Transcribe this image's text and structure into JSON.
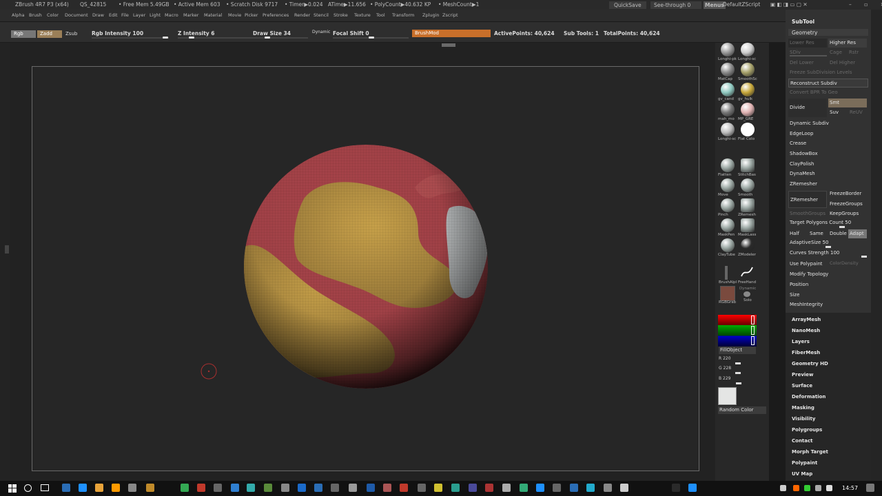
{
  "titlebar": {
    "app": "ZBrush 4R7 P3 (x64)",
    "qs": "QS_42815",
    "free_mem": "• Free Mem 5.49GB",
    "active_mem": "• Active Mem 603",
    "scratch": "• Scratch Disk 9717",
    "timer": "• Timer▶0.024",
    "atime": "ATime▶11.656",
    "polycount": "• PolyCount▶40.632 KP",
    "meshcount": "• MeshCount▶1",
    "quicksave": "QuickSave",
    "see_through": "See-through  0",
    "menus": "Menus",
    "script": "DefaultZScript"
  },
  "menubar": [
    "Alpha",
    "Brush",
    "Color",
    "Document",
    "Draw",
    "Edit",
    "File",
    "Layer",
    "Light",
    "Macro",
    "Marker",
    "Material",
    "Movie",
    "Picker",
    "Preferences",
    "Render",
    "Stencil",
    "Stroke",
    "Texture",
    "Tool",
    "Transform",
    "Zplugin",
    "Zscript"
  ],
  "toolbar": {
    "rgb": "Rgb",
    "zadd": "Zadd",
    "zsub": "Zsub",
    "rgb_intensity": "Rgb Intensity 100",
    "z_intensity": "Z Intensity 6",
    "draw_size": "Draw Size 34",
    "dynamic": "Dynamic",
    "focal_shift": "Focal Shift 0",
    "brushmod": "BrushMod",
    "active_points": "ActivePoints: 40,624",
    "sub_tools": "Sub Tools: 1",
    "total_points": "TotalPoints: 40,624"
  },
  "brushes": [
    {
      "label": "Longhi-pk",
      "color": "#9a9a9a"
    },
    {
      "label": "Longhi-sc",
      "color": "#cfcfcf"
    },
    {
      "label": "MatCap",
      "color": "#8a8a8a"
    },
    {
      "label": "SmoothSc",
      "color": "#a6a16a"
    },
    {
      "label": "gv_cand",
      "color": "#8fc9c0"
    },
    {
      "label": "gv_hulk",
      "color": "#c7a83a"
    },
    {
      "label": "mah_mo",
      "color": "#777777"
    },
    {
      "label": "MP_GRE",
      "color": "#e0b2b2"
    },
    {
      "label": "Longhi-sc",
      "color": "#bdbdbd"
    },
    {
      "label": "Flat Colo",
      "color": "#ffffff"
    },
    {
      "label": "Flatten",
      "color": "#9aa6a2"
    },
    {
      "label": "StitchBas",
      "color": "#9aa6a2"
    },
    {
      "label": "Move",
      "color": "#9aa6a2"
    },
    {
      "label": "Smooth",
      "color": "#9aa6a2"
    },
    {
      "label": "Pinch",
      "color": "#9aa6a2"
    },
    {
      "label": "ZRemesh",
      "color": "#9aa6a2"
    },
    {
      "label": "MaskPen",
      "color": "#9aa6a2"
    },
    {
      "label": "MaskLass",
      "color": "#9aa6a2"
    },
    {
      "label": "ClayTube",
      "color": "#9aa6a2"
    },
    {
      "label": "ZModeler",
      "color": "#2a2a2a"
    }
  ],
  "stroke": {
    "alpha_label": "BrushAlpl",
    "freehand_label": "FreeHand",
    "texture_label": "RGBGrab",
    "dynamic_label": "Dynamic",
    "solo_label": "Solo"
  },
  "color": {
    "fill_object": "FillObject",
    "r": "R 220",
    "g": "G 228",
    "b": "B 229",
    "random": "Random Color",
    "swatch": "#e4e5e4"
  },
  "subtool": {
    "header": "SubTool",
    "geometry": "Geometry",
    "lower_res": "Lower Res",
    "higher_res": "Higher Res",
    "sdiv": "SDiv",
    "cage": "Cage",
    "rstr": "Rstr",
    "del_lower": "Del Lower",
    "del_higher": "Del Higher",
    "freeze_subdiv": "Freeze SubDivision Levels",
    "reconstruct": "Reconstruct Subdiv",
    "convert_bpr": "Convert BPR To Geo",
    "divide": "Divide",
    "smt": "Smt",
    "suv": "Suv",
    "reuv": "ReUV",
    "dynamic_subdiv": "Dynamic Subdiv",
    "edgeloop": "EdgeLoop",
    "crease": "Crease",
    "shadowbox": "ShadowBox",
    "claypolish": "ClayPolish",
    "dynamesh": "DynaMesh",
    "zremesher_h": "ZRemesher",
    "zremesher": "ZRemesher",
    "freezeborder": "FreezeBorder",
    "freezegroups": "FreezeGroups",
    "smoothgroups": "SmoothGroups",
    "keepgroups": "KeepGroups",
    "target_poly": "Target Polygons Count 50",
    "half": "Half",
    "same": "Same",
    "double": "Double",
    "adapt": "Adapt",
    "adaptive_size": "AdaptiveSize 50",
    "curves_strength": "Curves Strength 100",
    "use_polypaint": "Use Polypaint",
    "color_density": "ColorDensity",
    "modify_topology": "Modify Topology",
    "position": "Position",
    "size": "Size",
    "mesh_integrity": "MeshIntegrity"
  },
  "rightlist": [
    "ArrayMesh",
    "NanoMesh",
    "Layers",
    "FiberMesh",
    "Geometry HD",
    "Preview",
    "Surface",
    "Deformation",
    "Masking",
    "Visibility",
    "Polygroups",
    "Contact",
    "Morph Target",
    "Polypaint",
    "UV Map"
  ],
  "taskbar": {
    "time": "14:57"
  }
}
